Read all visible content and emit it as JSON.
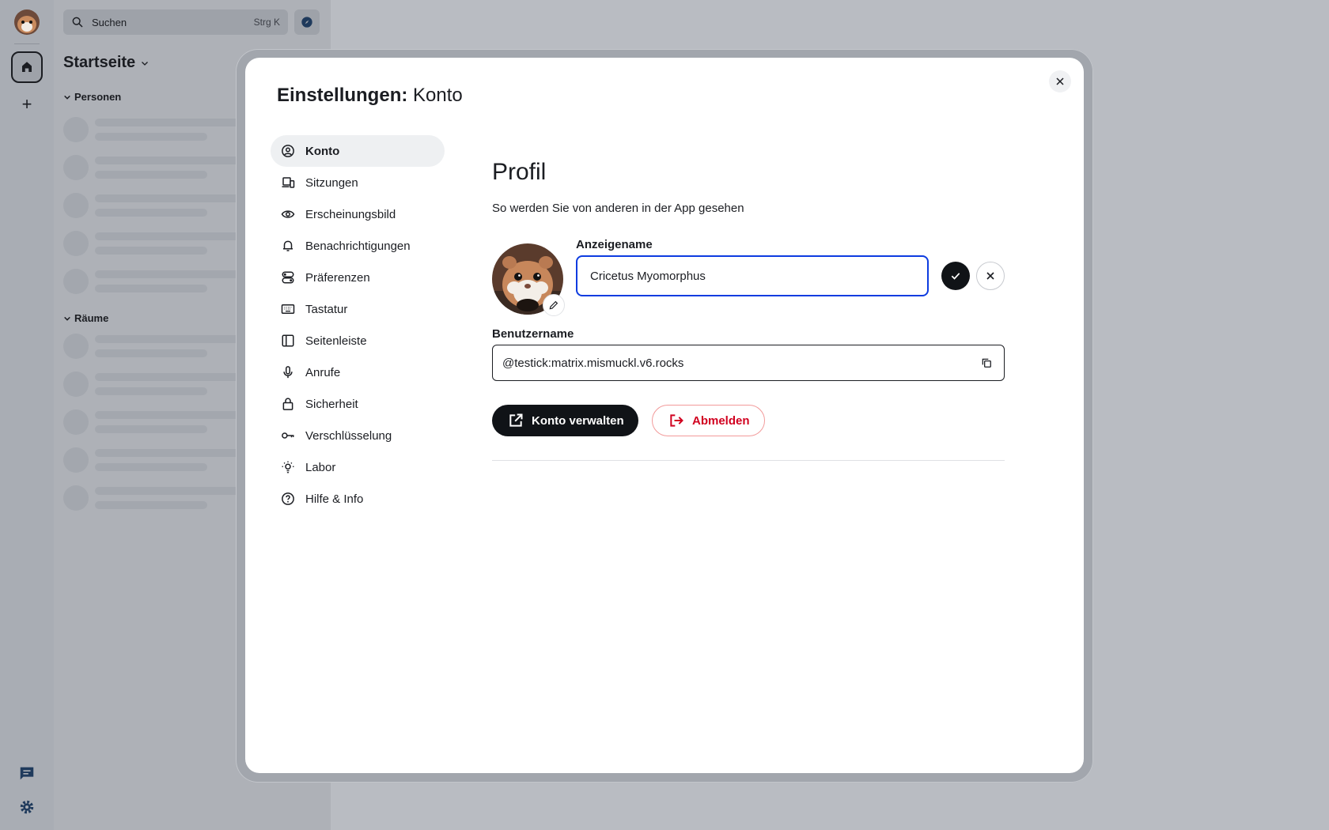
{
  "app": {
    "search": {
      "label": "Suchen",
      "shortcut": "Strg K"
    },
    "home_title": "Startseite",
    "sections": {
      "people": "Personen",
      "rooms": "Räume"
    }
  },
  "dialog": {
    "title_bold": "Einstellungen:",
    "title_rest": "Konto",
    "nav": [
      {
        "label": "Konto",
        "icon": "user-circle-icon",
        "active": true
      },
      {
        "label": "Sitzungen",
        "icon": "devices-icon"
      },
      {
        "label": "Erscheinungsbild",
        "icon": "eye-icon"
      },
      {
        "label": "Benachrichtigungen",
        "icon": "bell-icon"
      },
      {
        "label": "Präferenzen",
        "icon": "toggles-icon"
      },
      {
        "label": "Tastatur",
        "icon": "keyboard-icon"
      },
      {
        "label": "Seitenleiste",
        "icon": "sidebar-icon"
      },
      {
        "label": "Anrufe",
        "icon": "microphone-icon"
      },
      {
        "label": "Sicherheit",
        "icon": "lock-icon"
      },
      {
        "label": "Verschlüsselung",
        "icon": "key-icon"
      },
      {
        "label": "Labor",
        "icon": "lightbulb-icon"
      },
      {
        "label": "Hilfe & Info",
        "icon": "help-circle-icon"
      }
    ],
    "profile": {
      "heading": "Profil",
      "subtitle": "So werden Sie von anderen in der App gesehen",
      "display_name_label": "Anzeigename",
      "display_name_value": "Cricetus Myomorphus",
      "username_label": "Benutzername",
      "username_value": "@testick:matrix.mismuckl.v6.rocks",
      "manage_account": "Konto verwalten",
      "logout": "Abmelden"
    }
  },
  "colors": {
    "accent_focus": "#0d3ce0",
    "danger": "#d1001f",
    "primary_button": "#101317"
  }
}
